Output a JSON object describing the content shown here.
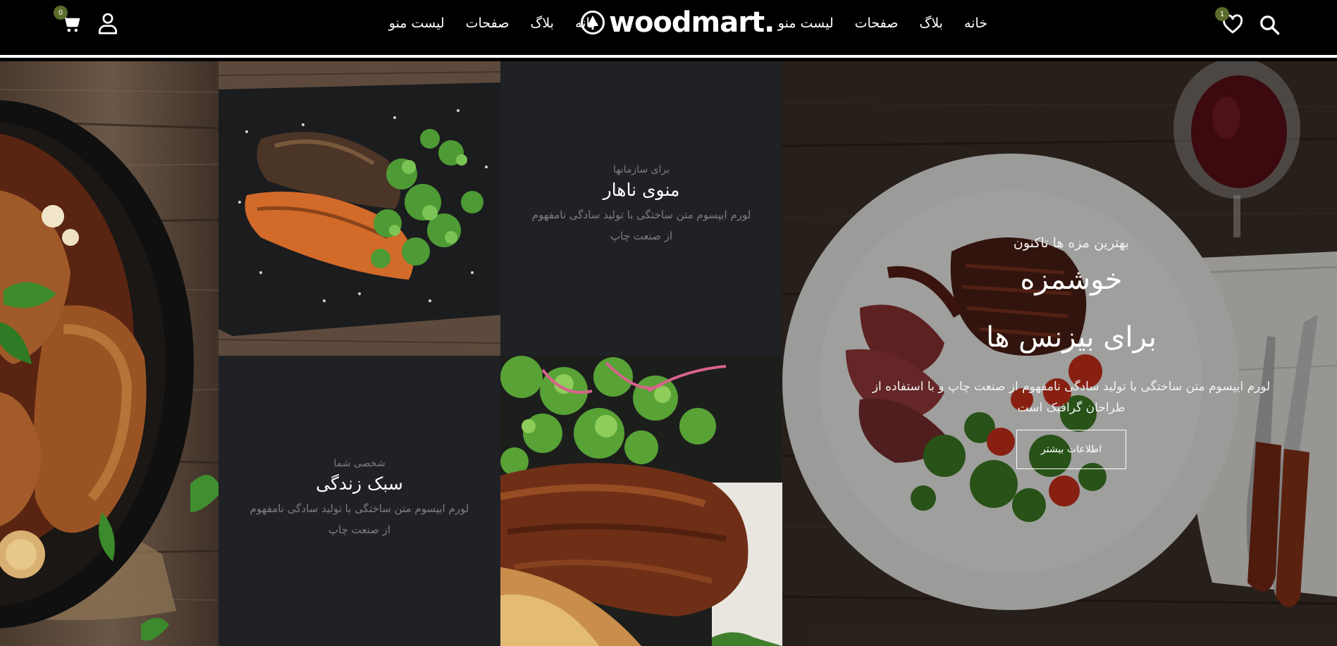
{
  "header": {
    "cart_count": "0",
    "wishlist_count": "1",
    "logo_text": "woodmart.",
    "nav_left": [
      "خانه",
      "بلاگ",
      "صفحات",
      "لیست منو"
    ],
    "nav_right": [
      "خانه",
      "بلاگ",
      "صفحات",
      "لیست منو"
    ],
    "icons": [
      "cart-icon",
      "user-icon",
      "heart-icon",
      "search-icon",
      "tree-icon"
    ]
  },
  "cards": {
    "lunch": {
      "subtitle": "برای سازمانها",
      "title": "منوی ناهار",
      "description": "لورم ایپسوم متن ساختگی با تولید سادگی نامفهوم از صنعت چاپ"
    },
    "lifestyle": {
      "subtitle": "شخصی شما",
      "title": "سبک زندگی",
      "description": "لورم ایپسوم متن ساختگی با تولید سادگی نامفهوم از صنعت چاپ"
    }
  },
  "hero": {
    "kicker": "بهترین مزه ها تاکنون",
    "title_line1": "خوشمزه",
    "title_line2": "برای بیزنس ها",
    "description": "لورم ایپسوم متن ساختگی با تولید سادگی نامفهوم از صنعت چاپ و با استفاده از طراحان گرافیک است",
    "button_label": "اطلاعات بیشتر"
  },
  "colors": {
    "header_bg": "#000000",
    "card_bg": "#1f2125",
    "muted_text": "#7c7e83",
    "badge": "#5b6b2a"
  }
}
